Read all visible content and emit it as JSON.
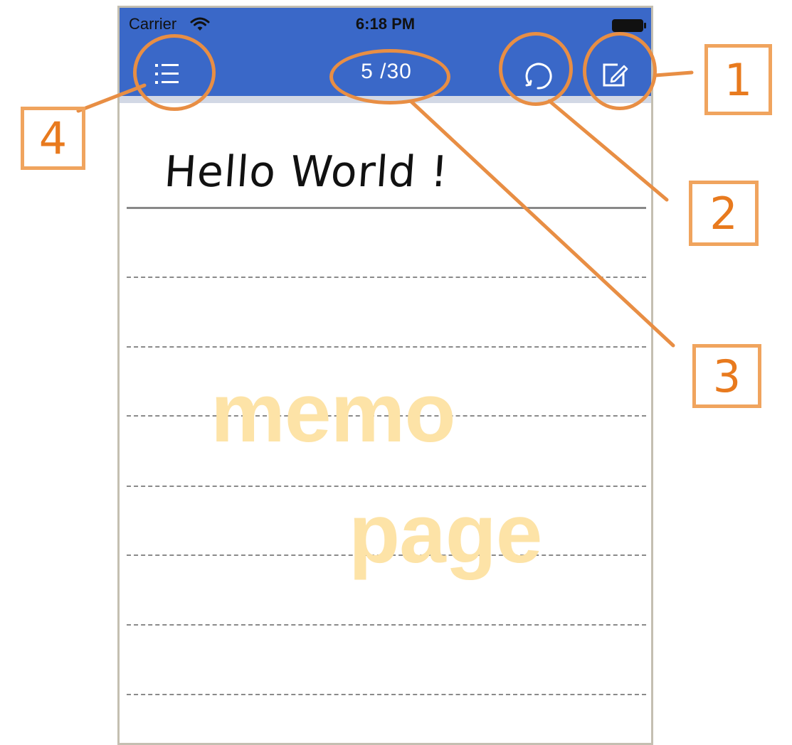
{
  "status_bar": {
    "carrier": "Carrier",
    "time": "6:18 PM",
    "wifi_icon": "wifi-icon",
    "battery_icon": "battery-full-icon"
  },
  "nav_bar": {
    "background": "#3a68c8",
    "menu_icon": "list-menu-icon",
    "page_counter": "5 /30",
    "refresh_icon": "refresh-icon",
    "compose_icon": "compose-edit-icon"
  },
  "memo": {
    "title": "Hello World !",
    "watermark_1": "memo",
    "watermark_2": "page",
    "watermark_color": "#fde3a7"
  },
  "annotations": {
    "color": "#e88e44",
    "labels": [
      "1",
      "2",
      "3",
      "4"
    ]
  }
}
